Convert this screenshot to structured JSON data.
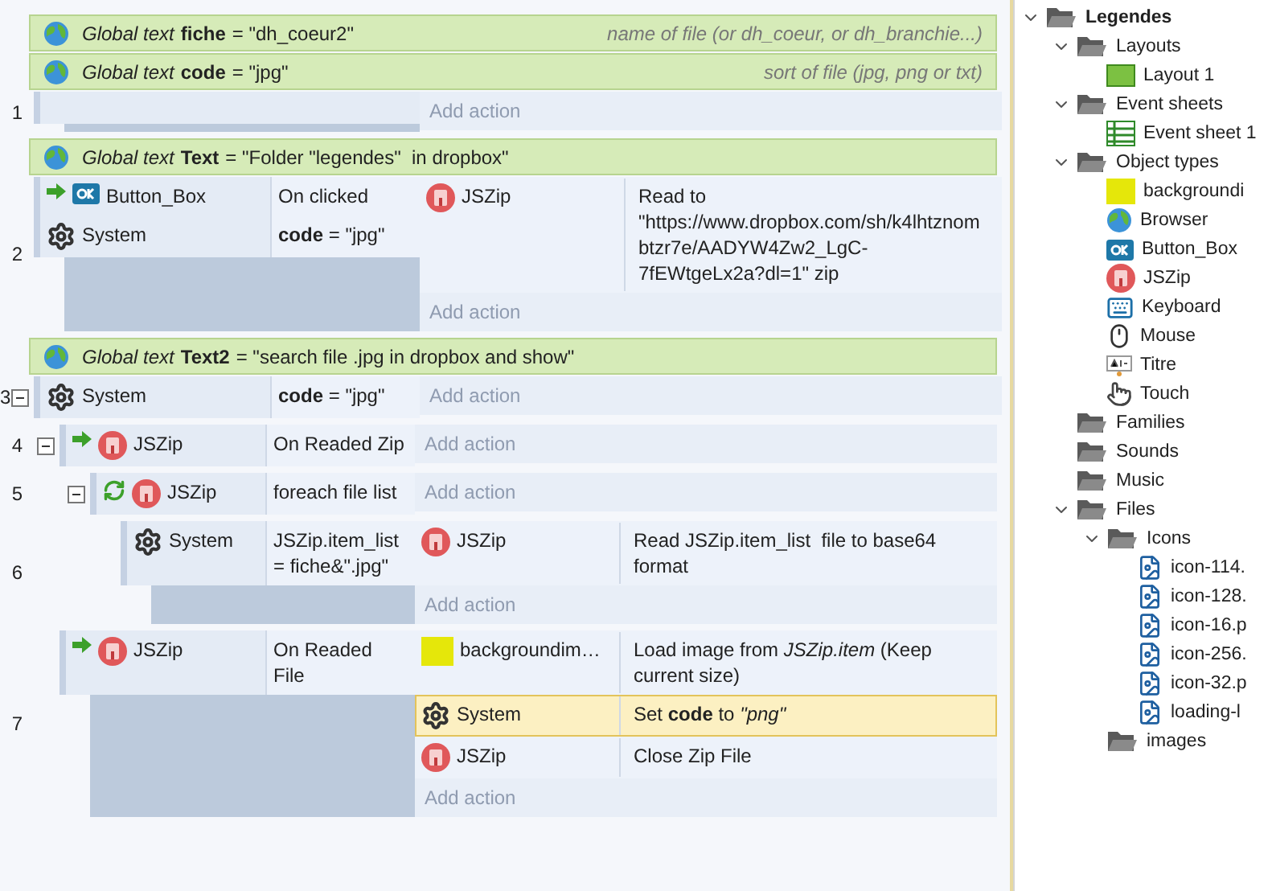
{
  "events": [
    {
      "kind": "global",
      "label": "Global text",
      "name": "fiche",
      "value": "= \"dh_coeur2\"",
      "comment": "name of file (or dh_coeur, or dh_branchie...)"
    },
    {
      "kind": "global",
      "label": "Global text",
      "name": "code",
      "value": "= \"jpg\"",
      "comment": "sort of file (jpg, png or txt)"
    },
    {
      "kind": "event",
      "number": "1",
      "add_action": "Add action"
    },
    {
      "kind": "global",
      "label": "Global text",
      "name": "Text",
      "value": "= \"Folder \"legendes\"  in dropbox\""
    },
    {
      "kind": "event",
      "number": "2",
      "conditions": [
        {
          "kind": "button",
          "trigger": true,
          "loop": false,
          "object": "Button_Box",
          "text": "On clicked"
        },
        {
          "kind": "system",
          "trigger": false,
          "loop": false,
          "object": "System",
          "text": "**code** = \"jpg\""
        }
      ],
      "actions": [
        {
          "kind": "jszip",
          "object": "JSZip",
          "text": "Read to \"https://www.dropbox.com/sh/k4lhtznombtzr7e/AADYW4Zw2_LgC-7fEWtgeLx2a?dl=1\" zip",
          "selected": false
        }
      ],
      "add_action": "Add action"
    },
    {
      "kind": "global",
      "label": "Global text",
      "name": "Text2",
      "value": "= \"search file .jpg in dropbox and show\""
    },
    {
      "kind": "event",
      "number": "3",
      "expanded": true,
      "conditions": [
        {
          "kind": "system",
          "trigger": false,
          "loop": false,
          "object": "System",
          "text": "**code** = \"jpg\""
        }
      ],
      "add_action": "Add action",
      "children": [
        {
          "kind": "event",
          "number": "4",
          "expanded": true,
          "conditions": [
            {
              "kind": "jszip",
              "trigger": true,
              "loop": false,
              "object": "JSZip",
              "text": "On Readed Zip"
            }
          ],
          "add_action": "Add action",
          "children": [
            {
              "kind": "event",
              "number": "5",
              "expanded": true,
              "conditions": [
                {
                  "kind": "jszip",
                  "trigger": false,
                  "loop": true,
                  "object": "JSZip",
                  "text": "foreach file list"
                }
              ],
              "add_action": "Add action",
              "children": [
                {
                  "kind": "event",
                  "number": "6",
                  "conditions": [
                    {
                      "kind": "system",
                      "trigger": false,
                      "loop": false,
                      "object": "System",
                      "text": "JSZip.item_list = fiche&\".jpg\""
                    }
                  ],
                  "actions": [
                    {
                      "kind": "jszip",
                      "object": "JSZip",
                      "text": "Read JSZip.item_list  file to base64 format",
                      "selected": false
                    }
                  ],
                  "add_action": "Add action"
                }
              ]
            }
          ]
        },
        {
          "kind": "event",
          "number": "7",
          "conditions": [
            {
              "kind": "jszip",
              "trigger": true,
              "loop": false,
              "object": "JSZip",
              "text": "On Readed File"
            }
          ],
          "actions": [
            {
              "kind": "sprite",
              "object": "backgroundim…",
              "text": "Load image from *JSZip.item* (Keep current size)",
              "selected": false
            },
            {
              "kind": "system",
              "object": "System",
              "text": "Set **code** to *\"png\"*",
              "selected": true
            },
            {
              "kind": "jszip",
              "object": "JSZip",
              "text": "Close Zip File",
              "selected": false
            }
          ],
          "add_action": "Add action"
        }
      ]
    }
  ],
  "project": {
    "items": [
      {
        "label": "Legendes",
        "kind": "folder",
        "expanded": true,
        "children": [
          {
            "label": "Layouts",
            "kind": "folder",
            "expanded": true,
            "children": [
              {
                "label": "Layout 1",
                "kind": "layout"
              }
            ]
          },
          {
            "label": "Event sheets",
            "kind": "folder",
            "expanded": true,
            "children": [
              {
                "label": "Event sheet 1",
                "kind": "sheet"
              }
            ]
          },
          {
            "label": "Object types",
            "kind": "folder",
            "expanded": true,
            "children": [
              {
                "label": "backgroundi",
                "kind": "sprite"
              },
              {
                "label": "Browser",
                "kind": "browser"
              },
              {
                "label": "Button_Box",
                "kind": "button"
              },
              {
                "label": "JSZip",
                "kind": "jszip"
              },
              {
                "label": "Keyboard",
                "kind": "keyboard"
              },
              {
                "label": "Mouse",
                "kind": "mouse"
              },
              {
                "label": "Titre",
                "kind": "text"
              },
              {
                "label": "Touch",
                "kind": "touch"
              }
            ]
          },
          {
            "label": "Families",
            "kind": "folder"
          },
          {
            "label": "Sounds",
            "kind": "folder"
          },
          {
            "label": "Music",
            "kind": "folder"
          },
          {
            "label": "Files",
            "kind": "folder",
            "expanded": true,
            "children": [
              {
                "label": "Icons",
                "kind": "folder",
                "expanded": true,
                "children": [
                  {
                    "label": "icon-114.",
                    "kind": "file"
                  },
                  {
                    "label": "icon-128.",
                    "kind": "file"
                  },
                  {
                    "label": "icon-16.p",
                    "kind": "file"
                  },
                  {
                    "label": "icon-256.",
                    "kind": "file"
                  },
                  {
                    "label": "icon-32.p",
                    "kind": "file"
                  },
                  {
                    "label": "loading-l",
                    "kind": "file"
                  }
                ]
              },
              {
                "label": "images",
                "kind": "folder"
              }
            ]
          }
        ]
      }
    ]
  }
}
